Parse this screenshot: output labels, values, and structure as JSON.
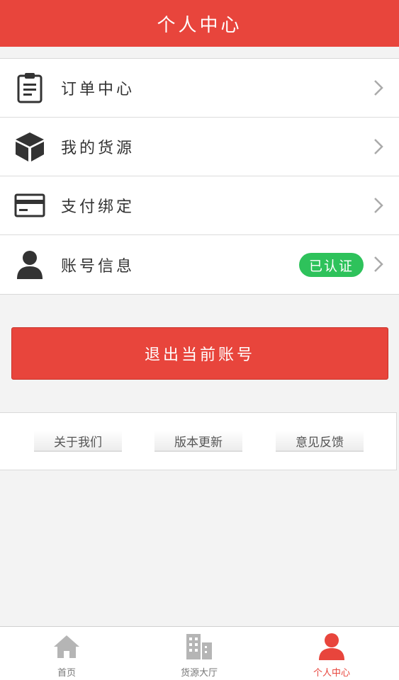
{
  "header": {
    "title": "个人中心"
  },
  "menu": {
    "items": [
      {
        "label": "订单中心",
        "icon": "clipboard-icon"
      },
      {
        "label": "我的货源",
        "icon": "box-icon"
      },
      {
        "label": "支付绑定",
        "icon": "credit-card-icon"
      },
      {
        "label": "账号信息",
        "icon": "user-icon",
        "badge": "已认证"
      }
    ]
  },
  "logout": {
    "label": "退出当前账号"
  },
  "links": {
    "about": "关于我们",
    "update": "版本更新",
    "feedback": "意见反馈"
  },
  "tabbar": {
    "home": "首页",
    "cargo_hall": "货源大厅",
    "profile": "个人中心"
  },
  "colors": {
    "brand": "#e8453c",
    "badge": "#2ec25b",
    "icon": "#333333",
    "tab_inactive": "#b5b5b5"
  }
}
